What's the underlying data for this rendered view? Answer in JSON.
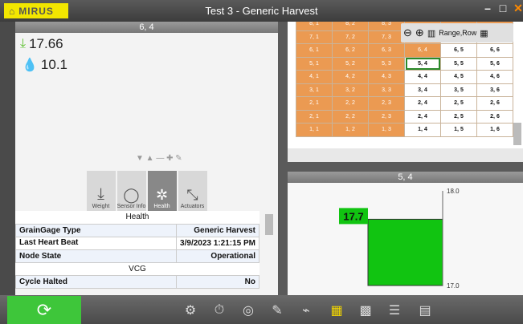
{
  "app": {
    "logo_text": "MIRUS",
    "title": "Test 3 - Generic Harvest"
  },
  "left_top": {
    "header": "6, 4",
    "moisture_value": "17.66",
    "water_value": "10.1"
  },
  "sensor_tabs": [
    {
      "label": "Weight"
    },
    {
      "label": "Sensor Info"
    },
    {
      "label": "Health"
    },
    {
      "label": "Actuators"
    }
  ],
  "health": {
    "section_health": "Health",
    "rows": [
      {
        "label": "GrainGage Type",
        "value": "Generic Harvest"
      },
      {
        "label": "Last Heart Beat",
        "value": "3/9/2023 1:21:15 PM"
      },
      {
        "label": "Node State",
        "value": "Operational"
      }
    ],
    "section_vcg": "VCG",
    "rows2": [
      {
        "label": "Cycle Halted",
        "value": "No"
      }
    ]
  },
  "grid": {
    "toolbar_label": "Range,Row",
    "rows": [
      [
        "8, 1",
        "8, 2",
        "8, 3",
        "",
        "",
        ""
      ],
      [
        "7, 1",
        "7, 2",
        "7, 3",
        "7, 4",
        "7, 5",
        "7, 6"
      ],
      [
        "6, 1",
        "6, 2",
        "6, 3",
        "6, 4",
        "6, 5",
        "6, 6"
      ],
      [
        "5, 1",
        "5, 2",
        "5, 3",
        "5, 4",
        "5, 5",
        "5, 6"
      ],
      [
        "4, 1",
        "4, 2",
        "4, 3",
        "4, 4",
        "4, 5",
        "4, 6"
      ],
      [
        "3, 1",
        "3, 2",
        "3, 3",
        "3, 4",
        "3, 5",
        "3, 6"
      ],
      [
        "2, 1",
        "2, 2",
        "2, 3",
        "2, 4",
        "2, 5",
        "2, 6"
      ],
      [
        "2, 1",
        "2, 2",
        "2, 3",
        "2, 4",
        "2, 5",
        "2, 6"
      ],
      [
        "1, 1",
        "1, 2",
        "1, 3",
        "1, 4",
        "1, 5",
        "1, 6"
      ]
    ],
    "selected": "5, 4"
  },
  "chart": {
    "header": "5, 4",
    "value_label": "17.7",
    "axis_top": "18.0",
    "axis_bottom": "17.0"
  },
  "chart_data": {
    "type": "bar",
    "categories": [
      ""
    ],
    "values": [
      17.7
    ],
    "ylim": [
      17.0,
      18.0
    ],
    "xlabel": "",
    "ylabel": ""
  },
  "colors": {
    "accent_green": "#3ec63a",
    "cell_orange": "#eb9a52",
    "bar_green": "#11c411"
  }
}
